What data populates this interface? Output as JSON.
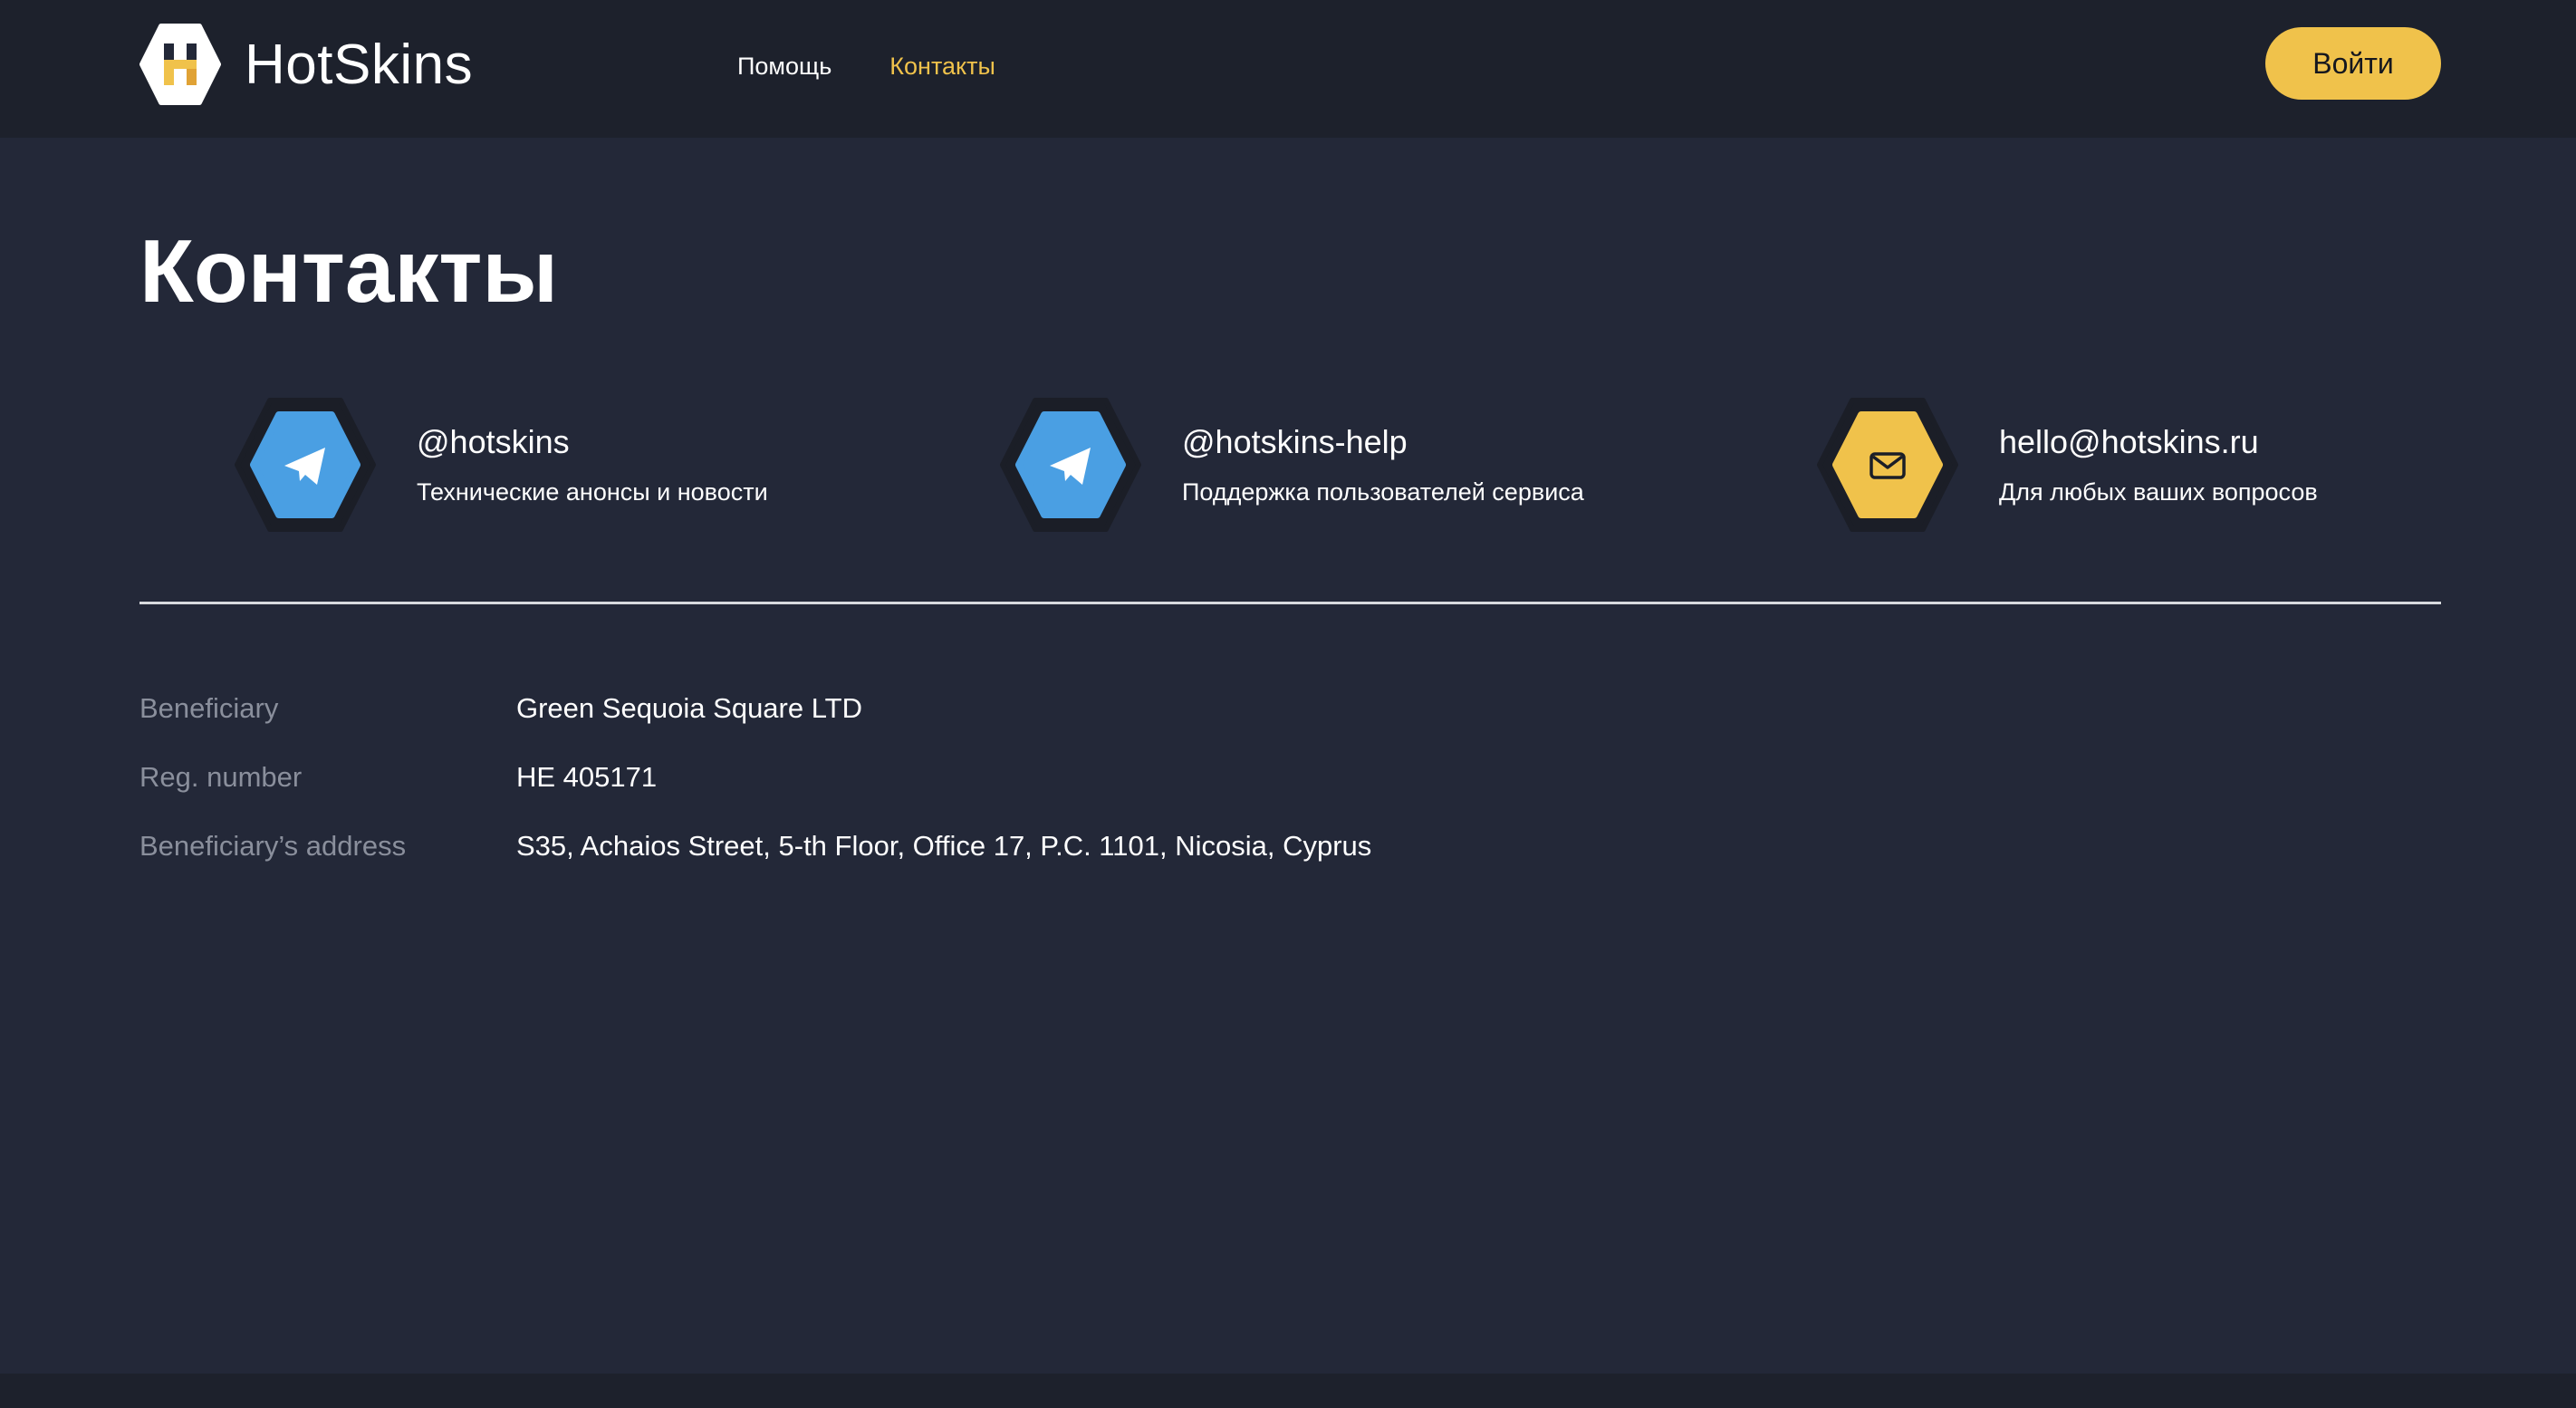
{
  "brand": {
    "name": "HotSkins",
    "accent": "#f0c24b",
    "bg": "#232838",
    "header_bg": "#1d212c"
  },
  "nav": {
    "items": [
      {
        "label": "Помощь",
        "active": false
      },
      {
        "label": "Контакты",
        "active": true
      }
    ]
  },
  "header": {
    "login_label": "Войти"
  },
  "page": {
    "title": "Контакты"
  },
  "contacts": [
    {
      "icon": "telegram-icon",
      "handle": "@hotskins",
      "description": "Технические анонсы и новости",
      "color": "#4a9fe3"
    },
    {
      "icon": "telegram-icon",
      "handle": "@hotskins-help",
      "description": "Поддержка пользователей сервиса",
      "color": "#4a9fe3"
    },
    {
      "icon": "mail-icon",
      "handle": "hello@hotskins.ru",
      "description": "Для любых ваших вопросов",
      "color": "#f0c24b"
    }
  ],
  "details": [
    {
      "label": "Beneficiary",
      "value": "Green Sequoia Square LTD"
    },
    {
      "label": "Reg. number",
      "value": "HE 405171"
    },
    {
      "label": "Beneficiary’s address",
      "value": "S35, Achaios Street, 5-th Floor, Office 17, P.C. 1101, Nicosia, Cyprus"
    }
  ],
  "footer": {
    "text": ""
  }
}
